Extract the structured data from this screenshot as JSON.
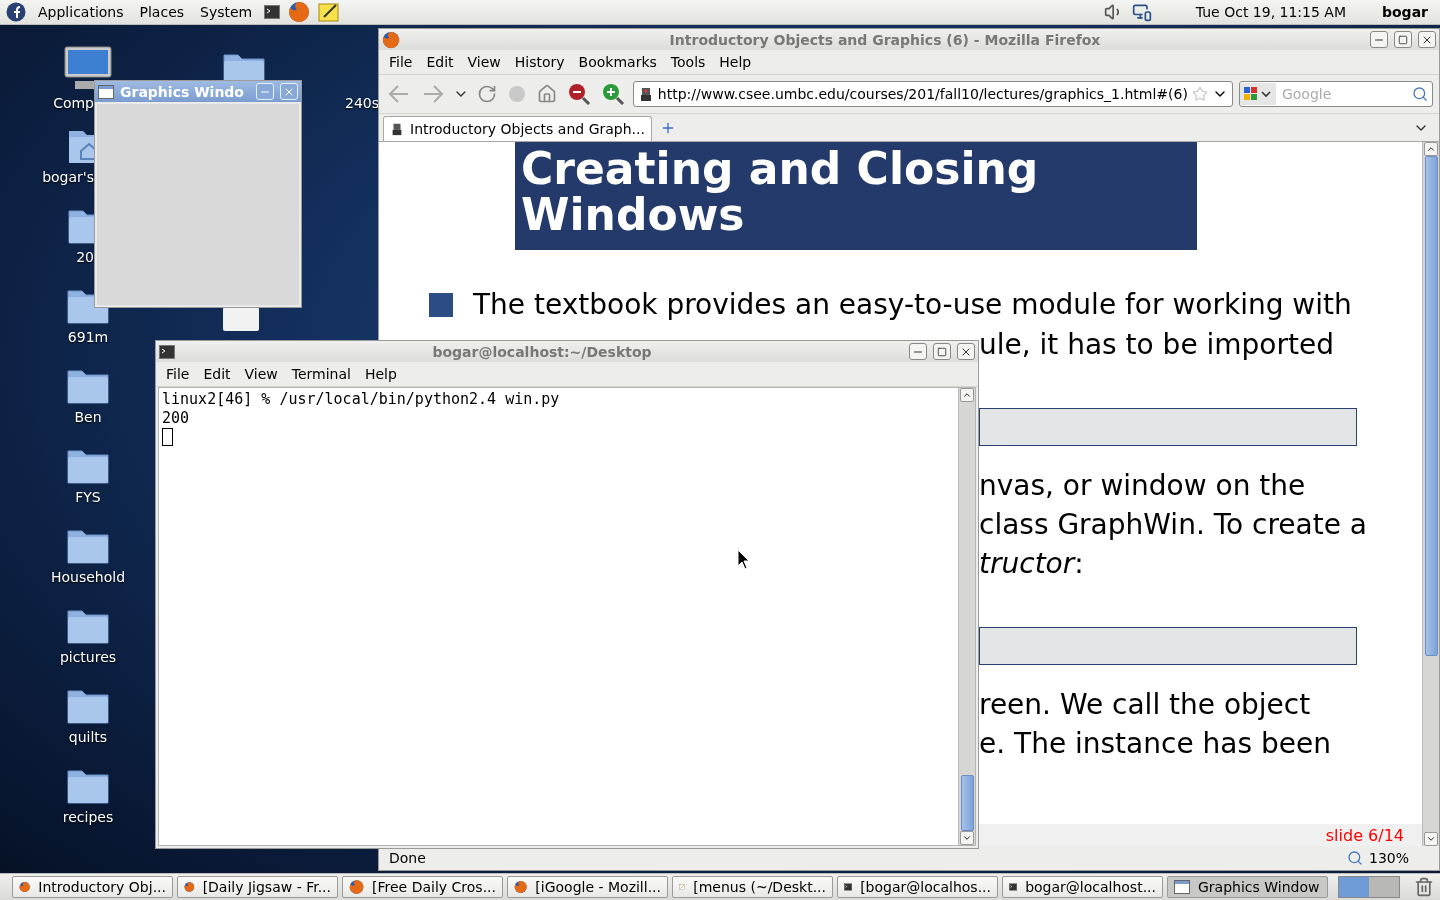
{
  "top_panel": {
    "menus": [
      "Applications",
      "Places",
      "System"
    ],
    "clock": "Tue Oct 19, 11:15 AM",
    "user": "bogar"
  },
  "desktop_icons": [
    {
      "label": "Comp",
      "kind": "computer"
    },
    {
      "label": "bogar's",
      "kind": "home"
    },
    {
      "label": "20",
      "kind": "folder"
    },
    {
      "label": "691m",
      "kind": "folder"
    },
    {
      "label": "Ben",
      "kind": "folder"
    },
    {
      "label": "FYS",
      "kind": "folder"
    },
    {
      "label": "Household",
      "kind": "folder"
    },
    {
      "label": "pictures",
      "kind": "folder"
    },
    {
      "label": "quilts",
      "kind": "folder"
    },
    {
      "label": "recipes",
      "kind": "folder"
    }
  ],
  "desktop_extra_label": "240s",
  "graphics_window": {
    "title": "Graphics Windo"
  },
  "firefox": {
    "title": "Introductory Objects and Graphics (6) - Mozilla Firefox",
    "menus": [
      "File",
      "Edit",
      "View",
      "History",
      "Bookmarks",
      "Tools",
      "Help"
    ],
    "url": "http://www.csee.umbc.edu/courses/201/fall10/lectures/graphics_1.html#(6)",
    "search_placeholder": "Google",
    "tabs": [
      {
        "label": "Introductory Objects and Graph...",
        "selected": true
      }
    ],
    "slide": {
      "title": "Creating and Closing Windows",
      "bullet": "The textbook provides an easy-to-use module for working with",
      "fragments": [
        {
          "kind": "text",
          "text": "ule, it has to be imported"
        },
        {
          "kind": "code"
        },
        {
          "kind": "text",
          "text": "nvas, or window on the"
        },
        {
          "kind": "text",
          "text": "class GraphWin. To create a"
        },
        {
          "kind": "text",
          "text": "*tructor*:"
        },
        {
          "kind": "code"
        },
        {
          "kind": "text",
          "text": "reen. We call the object"
        },
        {
          "kind": "text",
          "text": "e. The instance has been"
        }
      ],
      "footer": "slide 6/14"
    },
    "status": "Done",
    "zoom": "130%"
  },
  "terminal": {
    "title": "bogar@localhost:~/Desktop",
    "menus": [
      "File",
      "Edit",
      "View",
      "Terminal",
      "Help"
    ],
    "lines": [
      "linux2[46] % /usr/local/bin/python2.4 win.py",
      "200"
    ]
  },
  "taskbar": [
    {
      "label": "Introductory Obj...",
      "kind": "firefox",
      "selected": false
    },
    {
      "label": "[Daily Jigsaw - Fr...",
      "kind": "firefox",
      "selected": false
    },
    {
      "label": "[Free Daily Cros...",
      "kind": "firefox",
      "selected": false
    },
    {
      "label": "[iGoogle - Mozill...",
      "kind": "firefox",
      "selected": false
    },
    {
      "label": "[menus (~/Deskt...",
      "kind": "editor",
      "selected": false
    },
    {
      "label": "[bogar@localhos...",
      "kind": "terminal",
      "selected": false
    },
    {
      "label": "bogar@localhost...",
      "kind": "terminal",
      "selected": false
    },
    {
      "label": "Graphics Window",
      "kind": "window",
      "selected": true
    }
  ]
}
